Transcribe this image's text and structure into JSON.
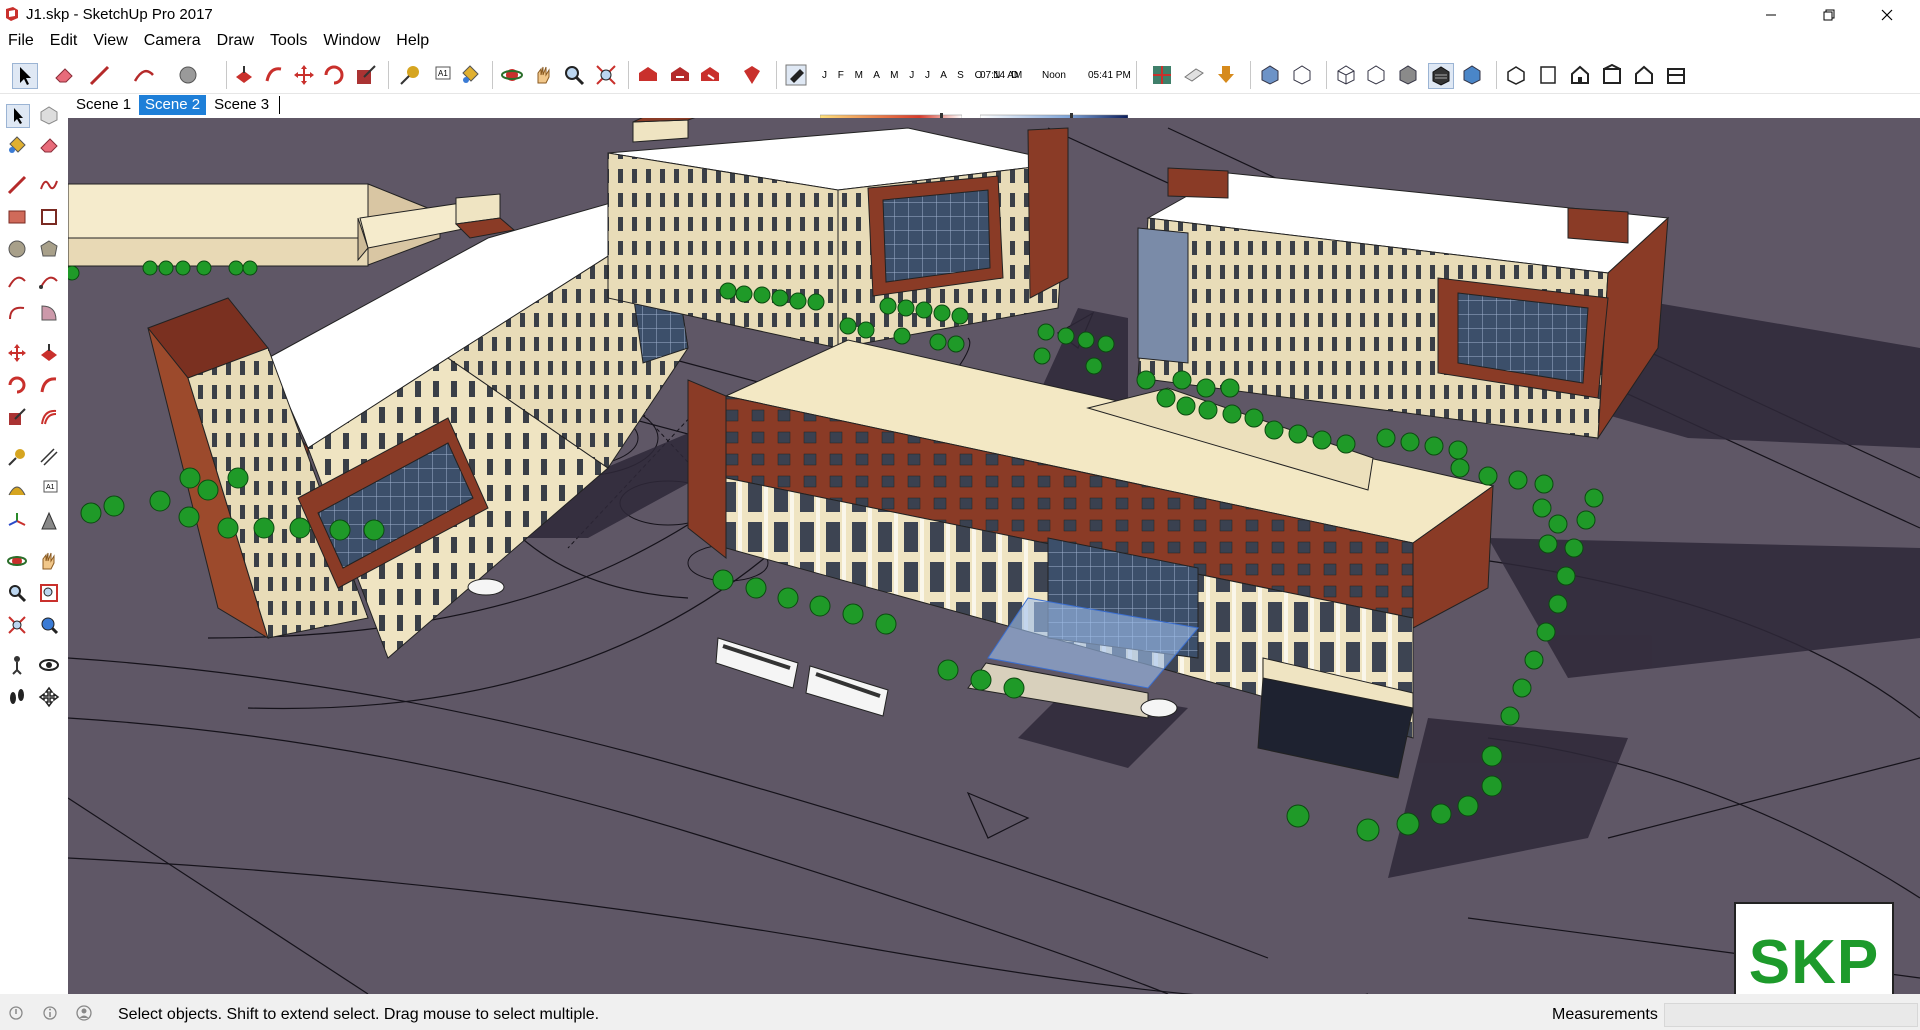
{
  "window": {
    "title": "J1.skp - SketchUp Pro 2017"
  },
  "menu": [
    "File",
    "Edit",
    "View",
    "Camera",
    "Draw",
    "Tools",
    "Window",
    "Help"
  ],
  "toolbar": {
    "months_label": "J F M A M J J A S O N D",
    "time_start": "07:14 AM",
    "time_mid": "Noon",
    "time_end": "05:41 PM"
  },
  "scenes": [
    {
      "label": "Scene 1",
      "active": false
    },
    {
      "label": "Scene 2",
      "active": true
    },
    {
      "label": "Scene 3",
      "active": false
    }
  ],
  "status": {
    "hint": "Select objects. Shift to extend select. Drag mouse to select multiple.",
    "measurements_label": "Measurements",
    "measurements_value": ""
  },
  "badge": {
    "text": "SKP"
  },
  "colors": {
    "viewport_bg": "#5f5766",
    "brick": "#8a3b26",
    "cream": "#efe4c2",
    "roof": "#ffffff",
    "tree": "#1f9a28",
    "selection_blue": "#1e7fd8"
  }
}
